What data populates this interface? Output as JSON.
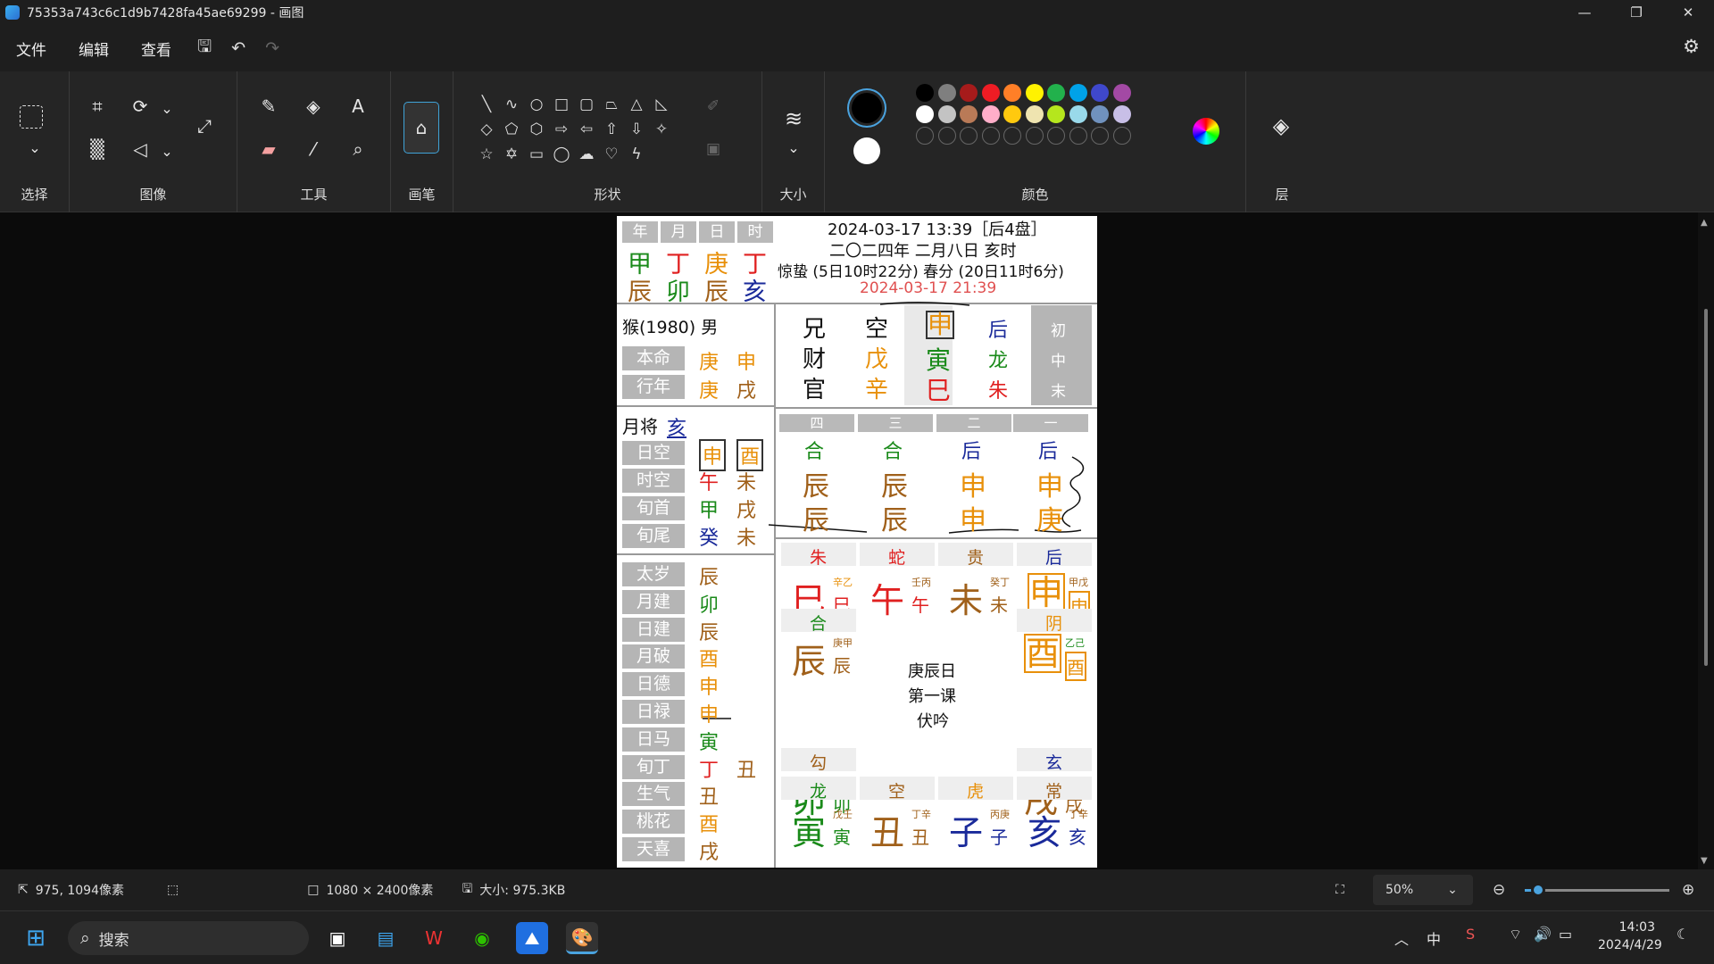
{
  "window": {
    "title": "75353a743c6c1d9b7428fa45ae69299 - 画图",
    "min": "—",
    "max": "❐",
    "close": "✕"
  },
  "menu": {
    "file": "文件",
    "edit": "编辑",
    "view": "查看"
  },
  "ribbon": {
    "groups": {
      "select": "选择",
      "image": "图像",
      "tools": "工具",
      "brush": "画笔",
      "shapes": "形状",
      "size": "大小",
      "colors": "颜色",
      "layers": "层"
    }
  },
  "palette": {
    "primary": "#000000",
    "secondary": "#ffffff",
    "row1": [
      "#000000",
      "#7f7f7f",
      "#a61b1b",
      "#ee1c24",
      "#ff7f27",
      "#fff200",
      "#22b14c",
      "#00a2e8",
      "#3f48cc",
      "#a349a4"
    ],
    "row2": [
      "#ffffff",
      "#c3c3c3",
      "#b97a57",
      "#ffaec9",
      "#ffc90e",
      "#efe4b0",
      "#b5e61d",
      "#99d9ea",
      "#7092be",
      "#c8bfe7"
    ]
  },
  "doc": {
    "header_cols": [
      "年",
      "月",
      "日",
      "时"
    ],
    "stems": [
      "甲",
      "丁",
      "庚",
      "丁"
    ],
    "branches": [
      "辰",
      "卯",
      "辰",
      "亥"
    ],
    "info1": "2024-03-17 13:39［后4盘］",
    "info2": "二〇二四年 二月八日 亥时",
    "info3": "惊蛰 (5日10时22分) 春分 (20日11时6分)",
    "info4": "2024-03-17 21:39",
    "person": "猴(1980) 男",
    "benming_label": "本命",
    "benming_a": "庚",
    "benming_b": "申",
    "xingnian_label": "行年",
    "xingnian_a": "庚",
    "xingnian_b": "戌",
    "yuejiang_label": "月将",
    "yuejiang_val": "亥",
    "kong_rows": [
      {
        "label": "日空",
        "a": "申",
        "b": "酉"
      },
      {
        "label": "时空",
        "a": "午",
        "b": "未"
      },
      {
        "label": "旬首",
        "a": "甲",
        "b": "戌"
      },
      {
        "label": "旬尾",
        "a": "癸",
        "b": "未"
      }
    ],
    "shen_rows": [
      {
        "label": "太岁",
        "a": "辰",
        "b": ""
      },
      {
        "label": "月建",
        "a": "卯",
        "b": ""
      },
      {
        "label": "日建",
        "a": "辰",
        "b": ""
      },
      {
        "label": "月破",
        "a": "酉",
        "b": ""
      },
      {
        "label": "日德",
        "a": "申",
        "b": ""
      },
      {
        "label": "日禄",
        "a": "申",
        "b": ""
      },
      {
        "label": "日马",
        "a": "寅",
        "b": ""
      },
      {
        "label": "旬丁",
        "a": "丁",
        "b": "丑"
      },
      {
        "label": "生气",
        "a": "丑",
        "b": ""
      },
      {
        "label": "桃花",
        "a": "酉",
        "b": ""
      },
      {
        "label": "天喜",
        "a": "戌",
        "b": ""
      }
    ],
    "chuan": {
      "c1": [
        "兄",
        "财",
        "官"
      ],
      "c2": [
        "空",
        "戊",
        "辛"
      ],
      "c3": [
        "申",
        "寅",
        "巳"
      ],
      "c4": [
        "后",
        "龙",
        "朱"
      ],
      "c5": [
        "初",
        "中",
        "末"
      ]
    },
    "ke": {
      "heads": [
        "四",
        "三",
        "二",
        "一"
      ],
      "gods": [
        "合",
        "合",
        "后",
        "后"
      ],
      "upper": [
        "辰",
        "辰",
        "申",
        "申"
      ],
      "lower": [
        "辰",
        "辰",
        "申",
        "庚"
      ]
    },
    "pan": {
      "top_gods": [
        "朱",
        "蛇",
        "贵",
        "后"
      ],
      "top_big": [
        "巳",
        "午",
        "未",
        "申"
      ],
      "top_small": [
        "巳",
        "午",
        "未",
        "申"
      ],
      "top_tiny": [
        "辛乙",
        "壬丙",
        "癸丁",
        "甲戊"
      ],
      "left_gods": [
        "合",
        "勾"
      ],
      "left_big": [
        "辰",
        "卯"
      ],
      "left_small": [
        "辰",
        "卯"
      ],
      "left_tiny": [
        "庚甲",
        "己癸"
      ],
      "right_gods": [
        "阴",
        "玄"
      ],
      "right_big": [
        "酉",
        "戌"
      ],
      "right_small": [
        "酉",
        "戌"
      ],
      "right_tiny": [
        "乙己",
        "丙庚"
      ],
      "bottom_gods": [
        "龙",
        "空",
        "虎",
        "常"
      ],
      "bottom_big": [
        "寅",
        "丑",
        "子",
        "亥"
      ],
      "bottom_small": [
        "寅",
        "丑",
        "子",
        "亥"
      ],
      "bottom_tiny": [
        "戊壬",
        "丁辛",
        "丙庚",
        "丁辛"
      ],
      "center1": "庚辰日",
      "center2": "第一课",
      "center3": "伏吟"
    }
  },
  "status": {
    "cursor": "975, 1094像素",
    "dims": "1080 × 2400像素",
    "size": "大小: 975.3KB",
    "zoom": "50%"
  },
  "taskbar": {
    "search": "搜索",
    "ime": "中",
    "time": "14:03",
    "date": "2024/4/29"
  }
}
